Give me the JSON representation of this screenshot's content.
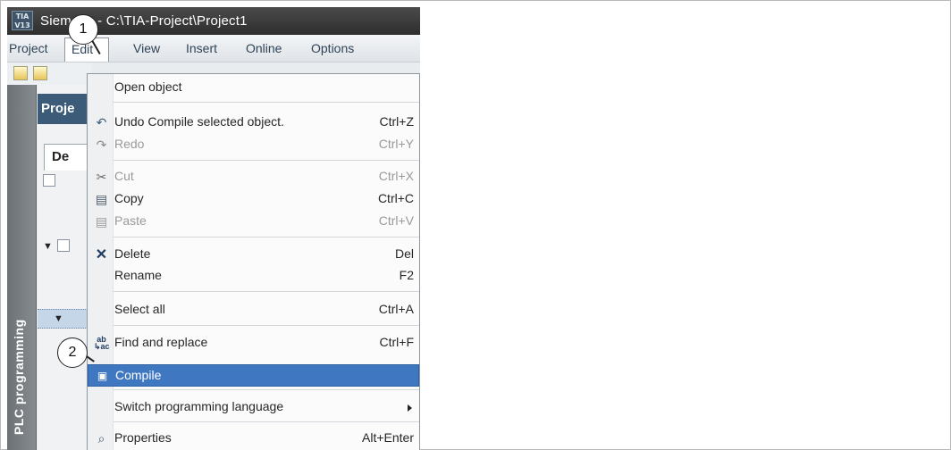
{
  "window": {
    "logo_text": "TIA V13",
    "title": "Siemens - C:\\TIA-Project\\Project1"
  },
  "menubar": {
    "items": [
      "Project",
      "Edit",
      "View",
      "Insert",
      "Online",
      "Options"
    ]
  },
  "project_pane": {
    "header": "Proje",
    "tab": "De"
  },
  "sidebar_label": "PLC programming",
  "edit_menu": {
    "items": [
      {
        "label": "Open object",
        "shortcut": "",
        "enabled": true,
        "icon": ""
      },
      {
        "label": "Undo Compile selected object.",
        "shortcut": "Ctrl+Z",
        "enabled": true,
        "icon": "undo-icon"
      },
      {
        "label": "Redo",
        "shortcut": "Ctrl+Y",
        "enabled": false,
        "icon": "redo-icon"
      },
      {
        "label": "Cut",
        "shortcut": "Ctrl+X",
        "enabled": false,
        "icon": "cut-icon"
      },
      {
        "label": "Copy",
        "shortcut": "Ctrl+C",
        "enabled": true,
        "icon": "copy-icon"
      },
      {
        "label": "Paste",
        "shortcut": "Ctrl+V",
        "enabled": false,
        "icon": "paste-icon"
      },
      {
        "label": "Delete",
        "shortcut": "Del",
        "enabled": true,
        "icon": "delete-icon"
      },
      {
        "label": "Rename",
        "shortcut": "F2",
        "enabled": true,
        "icon": ""
      },
      {
        "label": "Select all",
        "shortcut": "Ctrl+A",
        "enabled": true,
        "icon": ""
      },
      {
        "label": "Find and replace",
        "shortcut": "Ctrl+F",
        "enabled": true,
        "icon": "find-replace-icon"
      },
      {
        "label": "Compile",
        "shortcut": "",
        "enabled": true,
        "highlighted": true,
        "icon": "compile-icon"
      },
      {
        "label": "Switch programming language",
        "shortcut": "",
        "enabled": true,
        "has_submenu": true,
        "icon": ""
      },
      {
        "label": "Properties",
        "shortcut": "Alt+Enter",
        "enabled": true,
        "icon": "properties-icon"
      }
    ]
  },
  "callouts": [
    "1",
    "2"
  ],
  "colors": {
    "highlight": "#3f78c1",
    "header": "#3b5b78",
    "sidebar": "#7a7f83"
  }
}
